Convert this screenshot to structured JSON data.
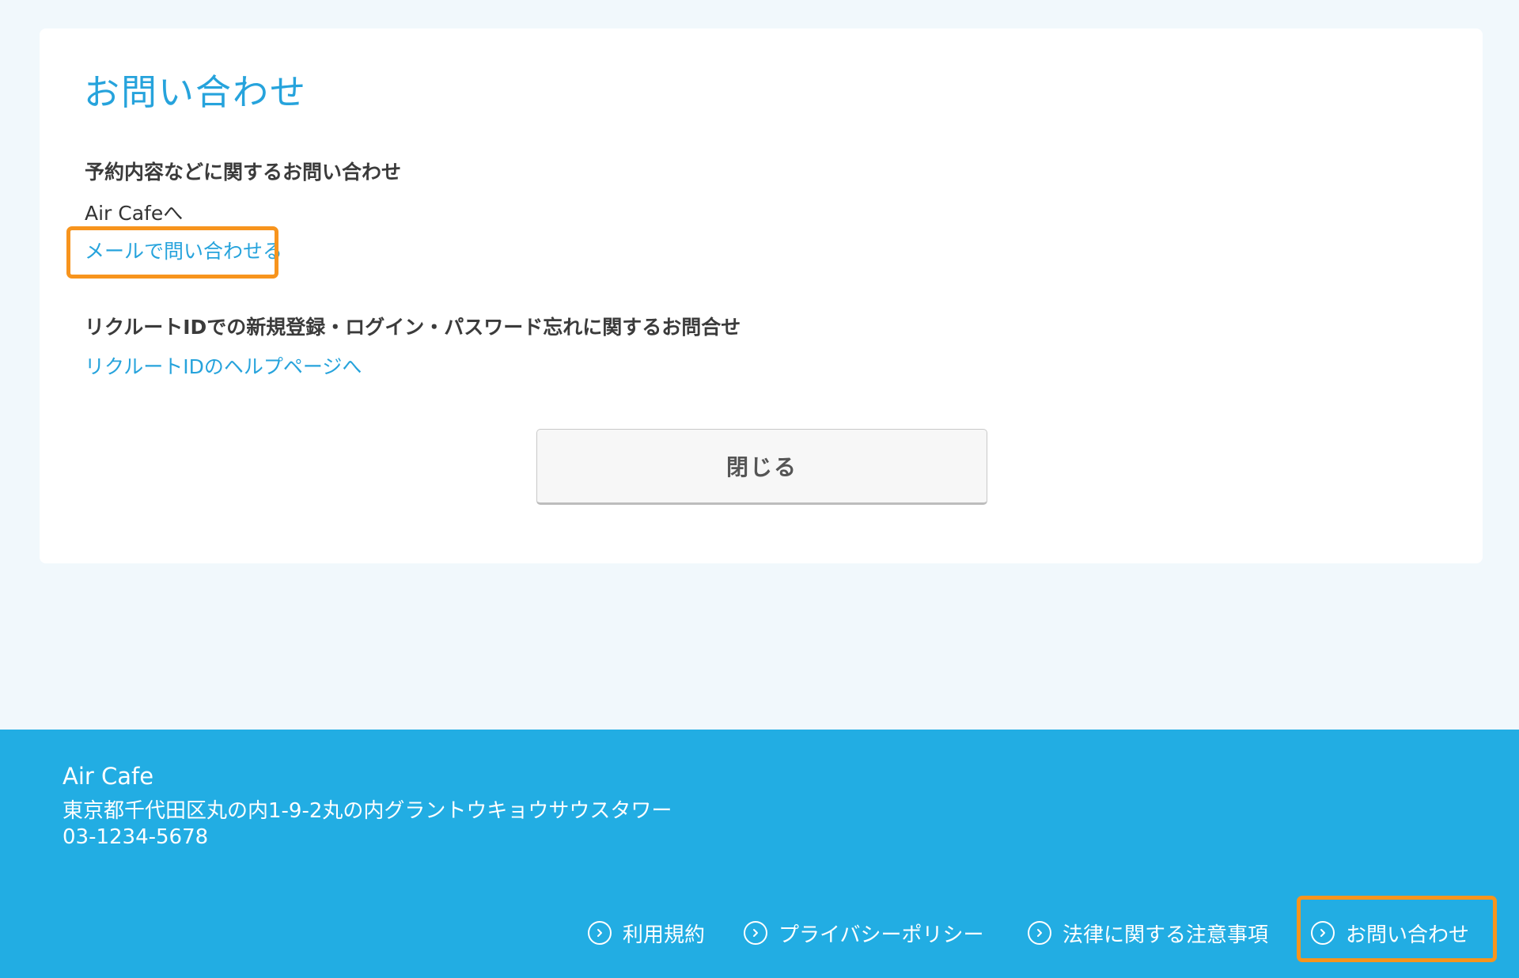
{
  "card": {
    "title": "お問い合わせ",
    "section1": {
      "heading": "予約内容などに関するお問い合わせ",
      "to_label": "Air Cafeへ",
      "link": "メールで問い合わせる"
    },
    "section2": {
      "heading": "リクルートIDでの新規登録・ログイン・パスワード忘れに関するお問合せ",
      "link": "リクルートIDのヘルプページへ"
    },
    "close_button": "閉じる"
  },
  "footer": {
    "name": "Air Cafe",
    "address": "東京都千代田区丸の内1-9-2丸の内グラントウキョウサウスタワー",
    "phone": "03-1234-5678",
    "nav": [
      {
        "label": "利用規約",
        "icon": "chevron-right-circle-icon"
      },
      {
        "label": "プライバシーポリシー",
        "icon": "chevron-right-circle-icon"
      },
      {
        "label": "法律に関する注意事項",
        "icon": "chevron-right-circle-icon"
      },
      {
        "label": "お問い合わせ",
        "icon": "chevron-right-circle-icon"
      }
    ]
  },
  "colors": {
    "accent": "#26a3dc",
    "footer_bg": "#22ade3",
    "highlight": "#f7941d",
    "page_bg": "#f1f8fc"
  }
}
